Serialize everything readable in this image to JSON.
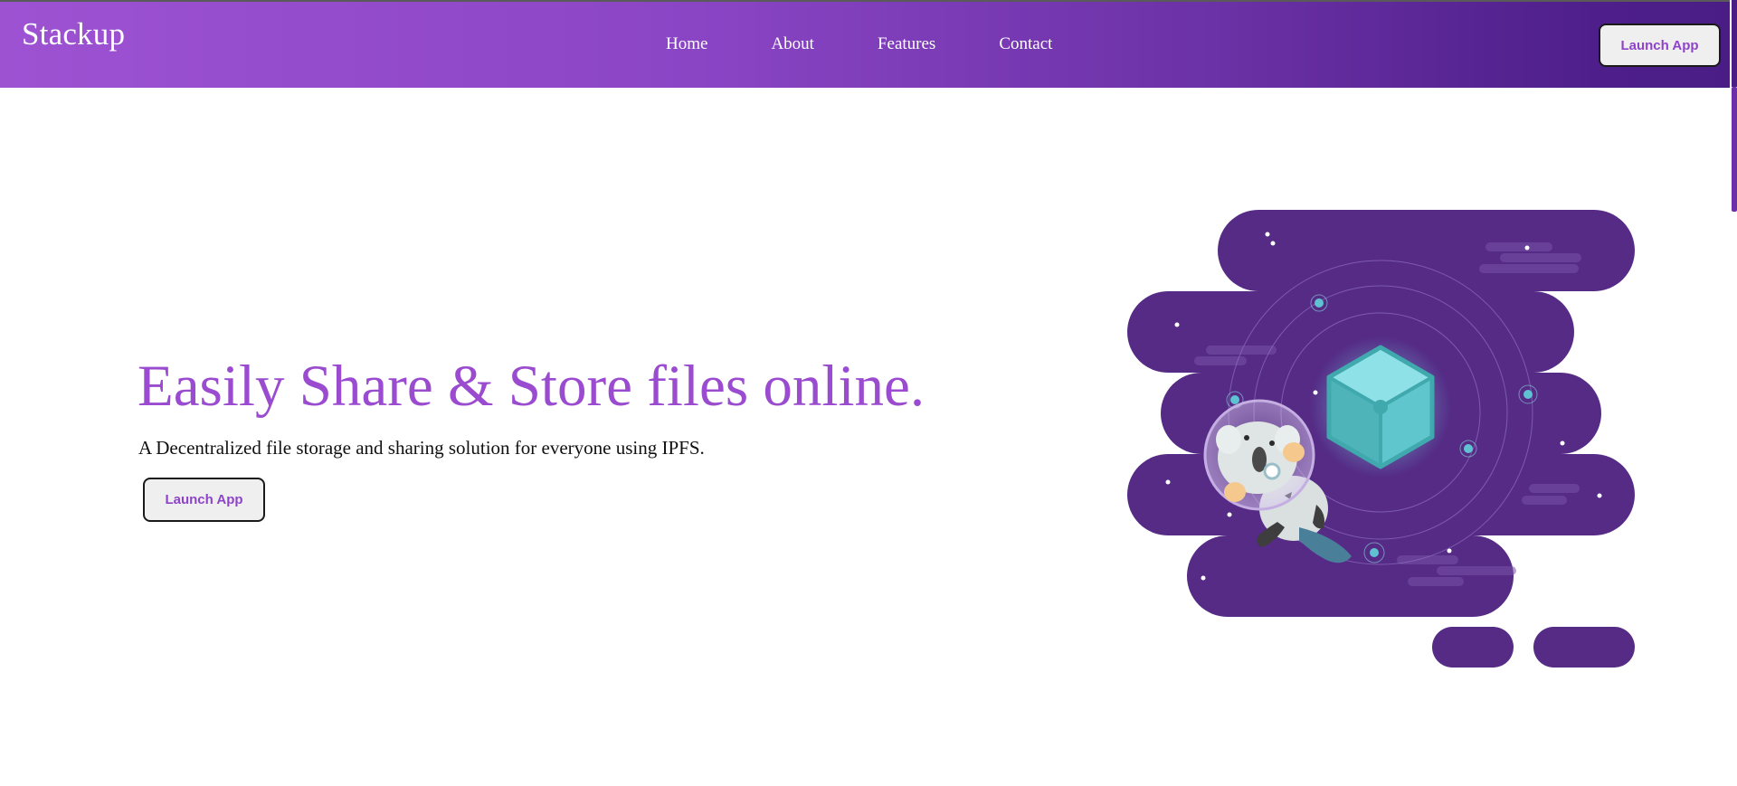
{
  "header": {
    "brand": "Stackup",
    "nav": [
      {
        "label": "Home"
      },
      {
        "label": "About"
      },
      {
        "label": "Features"
      },
      {
        "label": "Contact"
      }
    ],
    "launch_label": "Launch App"
  },
  "hero": {
    "title": "Easily Share & Store files online.",
    "subtitle": "A Decentralized file storage and sharing solution for everyone using IPFS.",
    "launch_label": "Launch App"
  },
  "illustration": {
    "icon": "astronaut-koala-cube-illustration",
    "colors": {
      "space": "#552b86",
      "cube": "#5fc6cd",
      "orbit_dot": "#5ec2d0",
      "accent": "#9a4bcf"
    }
  }
}
